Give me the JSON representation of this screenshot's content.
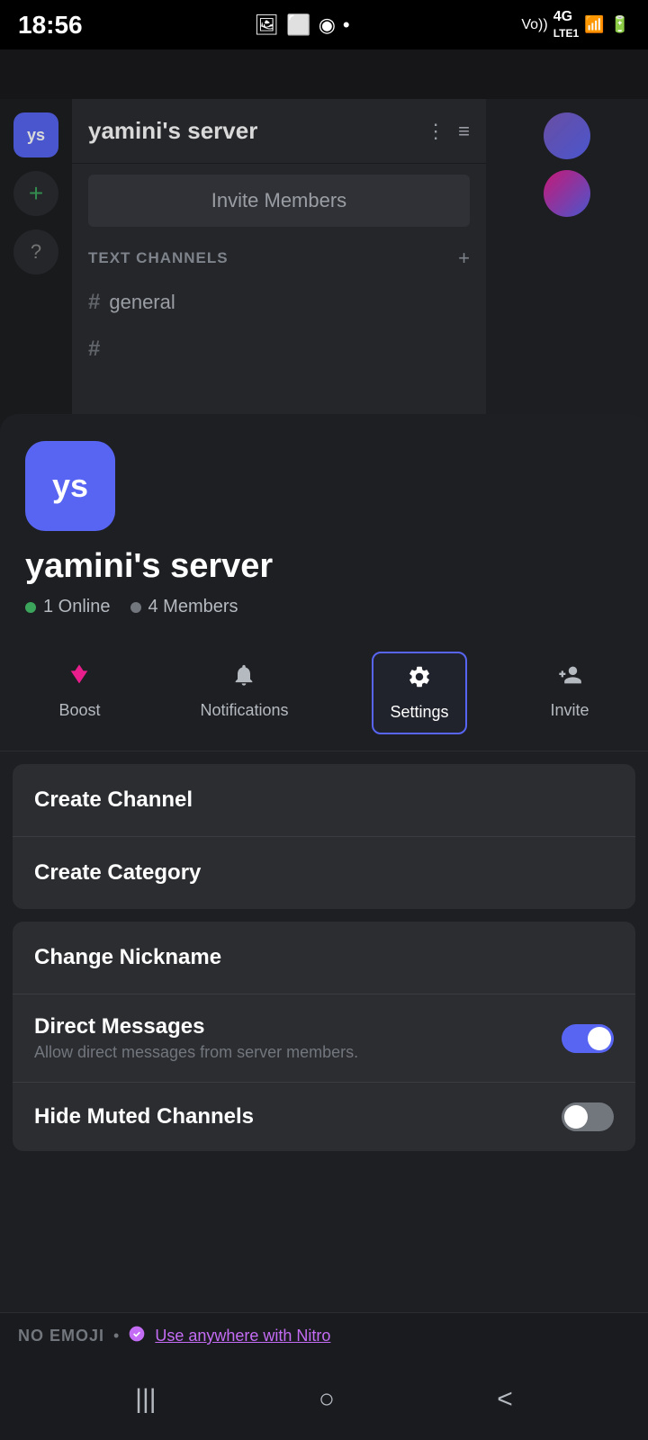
{
  "statusBar": {
    "time": "18:56",
    "leftIcons": [
      "photo-icon",
      "screen-icon",
      "chrome-icon",
      "dot-icon"
    ],
    "rightIcons": [
      "vol-icon",
      "4g-icon",
      "signal-icon",
      "battery-icon"
    ]
  },
  "background": {
    "serverName": "yamini's server",
    "inviteButton": "Invite Members",
    "categoryName": "TEXT CHANNELS",
    "channels": [
      {
        "name": "general"
      }
    ],
    "serverInitials": "ys"
  },
  "bottomSheet": {
    "serverInitials": "ys",
    "serverName": "yamini's server",
    "stats": {
      "online": "1 Online",
      "members": "4 Members"
    },
    "tabs": [
      {
        "id": "boost",
        "label": "Boost",
        "icon": "💎"
      },
      {
        "id": "notifications",
        "label": "Notifications",
        "icon": "🔔"
      },
      {
        "id": "settings",
        "label": "Settings",
        "icon": "⚙️"
      },
      {
        "id": "invite",
        "label": "Invite",
        "icon": "👤"
      }
    ],
    "activeTab": "settings",
    "menuSection1": {
      "items": [
        {
          "id": "create-channel",
          "label": "Create Channel"
        },
        {
          "id": "create-category",
          "label": "Create Category"
        }
      ]
    },
    "menuSection2": {
      "items": [
        {
          "id": "change-nickname",
          "label": "Change Nickname",
          "hasToggle": false
        },
        {
          "id": "direct-messages",
          "label": "Direct Messages",
          "subtitle": "Allow direct messages from server members.",
          "hasToggle": true,
          "toggleOn": true
        },
        {
          "id": "hide-muted-channels",
          "label": "Hide Muted Channels",
          "hasToggle": true,
          "toggleOn": false
        }
      ]
    }
  },
  "nitroBar": {
    "noEmoji": "NO EMOJI",
    "separator": "•",
    "linkText": "Use anywhere with Nitro"
  },
  "navBar": {
    "buttons": [
      "|||",
      "○",
      "<"
    ]
  }
}
